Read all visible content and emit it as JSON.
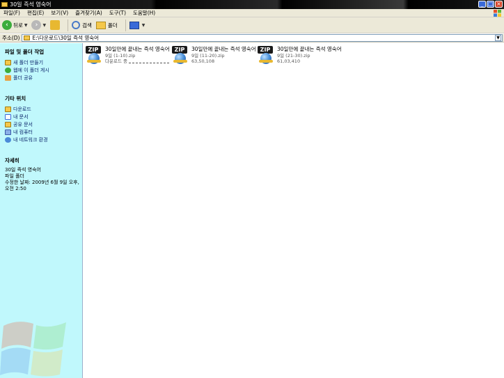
{
  "window": {
    "title": "30일 즉석 영숙어"
  },
  "menu": [
    "파일(F)",
    "편집(E)",
    "보기(V)",
    "즐겨찾기(A)",
    "도구(T)",
    "도움말(H)"
  ],
  "toolbar": {
    "back_label": "뒤로",
    "search_label": "검색",
    "folders_label": "폴더"
  },
  "address": {
    "label": "주소(D)",
    "path": "E:\\다운로드\\30일 즉석 영숙어"
  },
  "leftpane": {
    "tasks_title": "파일 및 폴더 작업",
    "tasks": [
      {
        "label": "새 폴더 만들기",
        "icon": "new-folder-icon"
      },
      {
        "label": "웹에 이 폴더 게시",
        "icon": "publish-web-icon"
      },
      {
        "label": "폴더 공유",
        "icon": "share-folder-icon"
      }
    ],
    "places_title": "기타 위치",
    "places": [
      {
        "label": "다운로드",
        "icon": "folder-icon"
      },
      {
        "label": "내 문서",
        "icon": "documents-icon"
      },
      {
        "label": "공유 문서",
        "icon": "shared-documents-icon"
      },
      {
        "label": "내 컴퓨터",
        "icon": "my-computer-icon"
      },
      {
        "label": "내 네트워크 환경",
        "icon": "network-icon"
      }
    ],
    "details_title": "자세히",
    "details_name": "30일 즉석 영숙어",
    "details_type": "파일 폴더",
    "details_modified": "수정한 날짜: 2009년 6월 9일 오후, 오전 2:50"
  },
  "files": [
    {
      "name": "30일만에 끝내는 즉석 영숙어",
      "type": "9일 (1-10).zip",
      "size": "다운로드 중"
    },
    {
      "name": "30일만에 끝내는 즉석 영숙어",
      "type": "9일 (11-20).zip",
      "size": "63,50,108"
    },
    {
      "name": "30일만에 끝내는 즉석 영숙어",
      "type": "9일 (21-30).zip",
      "size": "61,03,410"
    }
  ]
}
